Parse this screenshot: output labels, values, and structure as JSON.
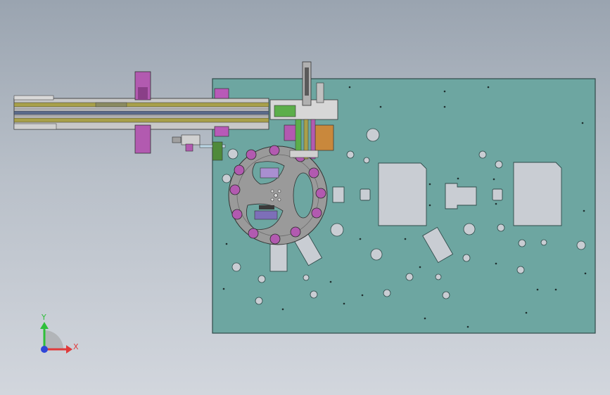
{
  "viewport": {
    "background_top": "#9aa4b0",
    "background_bottom": "#d2d6dd"
  },
  "colors": {
    "base_plate": "#6da6a1",
    "plate_edge": "#2f4a49",
    "turntable": "#9a9a9a",
    "rail_yellow": "#a8a04a",
    "magenta": "#b25ab0",
    "cutout": "#c9cdd3",
    "orange": "#c9883c",
    "green": "#5cae4a"
  },
  "triad": {
    "y_label": "Y",
    "x_label": "X",
    "y_color": "#2fbf3a",
    "x_color": "#e03a3a",
    "z_color": "#2f46d8"
  }
}
